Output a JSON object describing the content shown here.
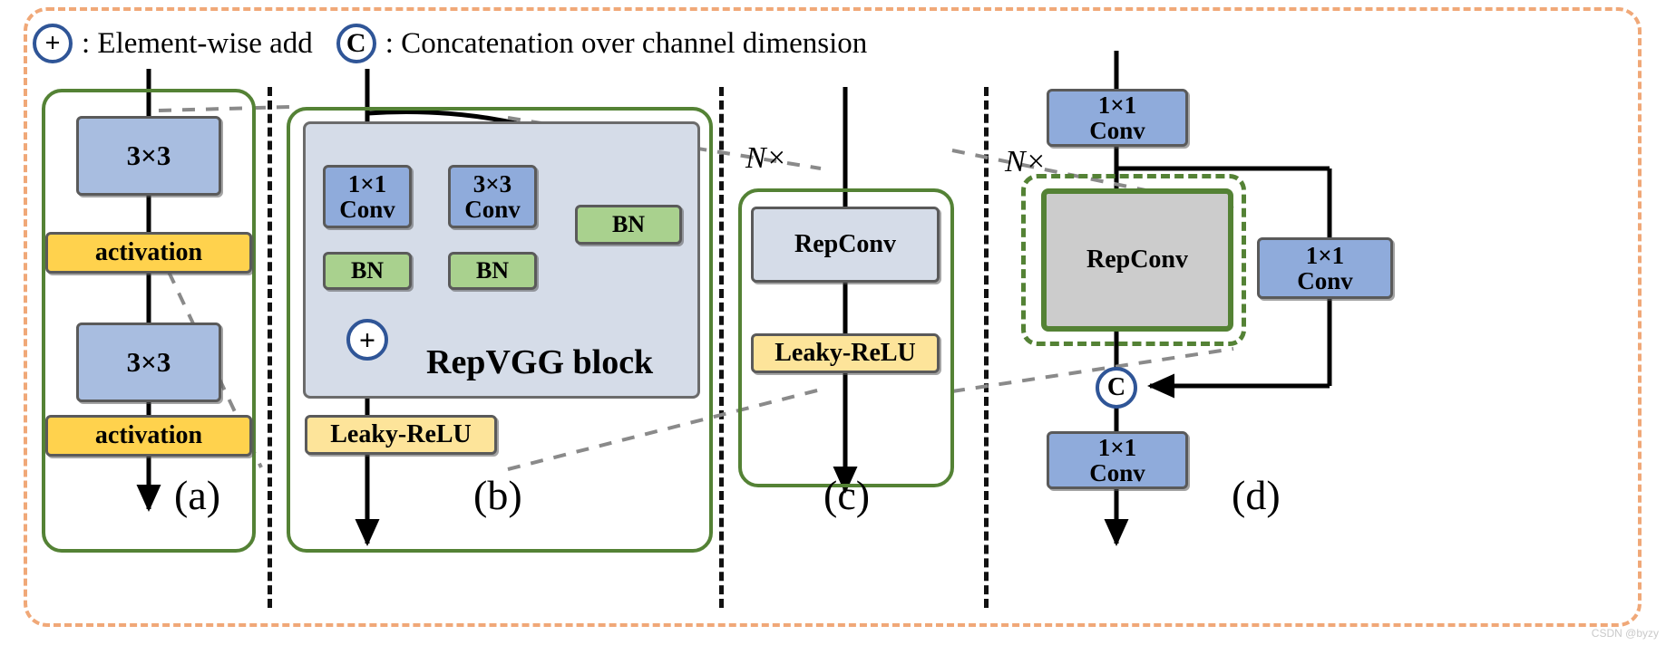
{
  "figure": {
    "legend": {
      "add_symbol": "+",
      "add_text": ": Element-wise add",
      "concat_symbol": "C",
      "concat_text": ": Concatenation over channel dimension"
    },
    "watermark": "CSDN @byzy",
    "colors": {
      "frame_dashed": "#f0a878",
      "group_green": "#548235",
      "conv_blue": "#a8bde0",
      "conv_blue_dark": "#8fabdb",
      "activation_yellow": "#ffd24d",
      "leaky_yellow": "#fde49a",
      "bn_green": "#a9d18e",
      "repvgg_panel_gray": "#d5dce8",
      "repconv_gray": "#cccccc",
      "circle_outline_blue": "#2f5597",
      "box_outline_gray": "#5a5a5a"
    },
    "panels": [
      {
        "id": "a",
        "label": "(a)",
        "nodes": [
          {
            "name": "conv-3x3-top",
            "text": "3×3",
            "type": "conv"
          },
          {
            "name": "activation-top",
            "text": "activation",
            "type": "activation"
          },
          {
            "name": "conv-3x3-bottom",
            "text": "3×3",
            "type": "conv"
          },
          {
            "name": "activation-bottom",
            "text": "activation",
            "type": "activation"
          }
        ]
      },
      {
        "id": "b",
        "label": "(b)",
        "block_title": "RepVGG block",
        "nodes": [
          {
            "name": "conv-1x1",
            "line1": "1×1",
            "line2": "Conv",
            "type": "conv"
          },
          {
            "name": "conv-3x3",
            "line1": "3×3",
            "line2": "Conv",
            "type": "conv"
          },
          {
            "name": "bn-left",
            "text": "BN",
            "type": "bn"
          },
          {
            "name": "bn-middle",
            "text": "BN",
            "type": "bn"
          },
          {
            "name": "bn-right",
            "text": "BN",
            "type": "bn"
          },
          {
            "name": "add-node",
            "text": "+",
            "type": "op"
          },
          {
            "name": "leaky-relu",
            "text": "Leaky-ReLU",
            "type": "activation"
          }
        ]
      },
      {
        "id": "c",
        "label": "(c)",
        "repeat": "N×",
        "nodes": [
          {
            "name": "repconv",
            "text": "RepConv",
            "type": "repconv"
          },
          {
            "name": "leaky-relu",
            "text": "Leaky-ReLU",
            "type": "activation"
          }
        ]
      },
      {
        "id": "d",
        "label": "(d)",
        "repeat": "N×",
        "nodes": [
          {
            "name": "conv-1x1-top",
            "line1": "1×1",
            "line2": "Conv",
            "type": "conv"
          },
          {
            "name": "repconv",
            "text": "RepConv",
            "type": "repconv"
          },
          {
            "name": "conv-1x1-right",
            "line1": "1×1",
            "line2": "Conv",
            "type": "conv"
          },
          {
            "name": "concat-node",
            "text": "C",
            "type": "op"
          },
          {
            "name": "conv-1x1-bottom",
            "line1": "1×1",
            "line2": "Conv",
            "type": "conv"
          }
        ]
      }
    ]
  }
}
